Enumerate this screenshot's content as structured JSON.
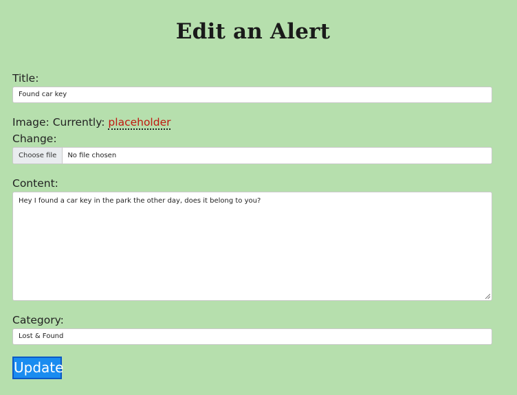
{
  "page": {
    "heading": "Edit an Alert"
  },
  "form": {
    "title_label": "Title:",
    "title_value": "Found car key",
    "image_label": "Image: Currently:",
    "image_current": "placeholder",
    "change_label": "Change:",
    "file_button": "Choose file",
    "file_status": "No file chosen",
    "content_label": "Content:",
    "content_value": "Hey I found a car key in the park the other day, does it belong to you?",
    "category_label": "Category:",
    "category_value": "Lost & Found",
    "submit_label": "Update"
  },
  "colors": {
    "background": "#b6dfad",
    "link": "#c0170f",
    "button": "#1a8cf0"
  }
}
